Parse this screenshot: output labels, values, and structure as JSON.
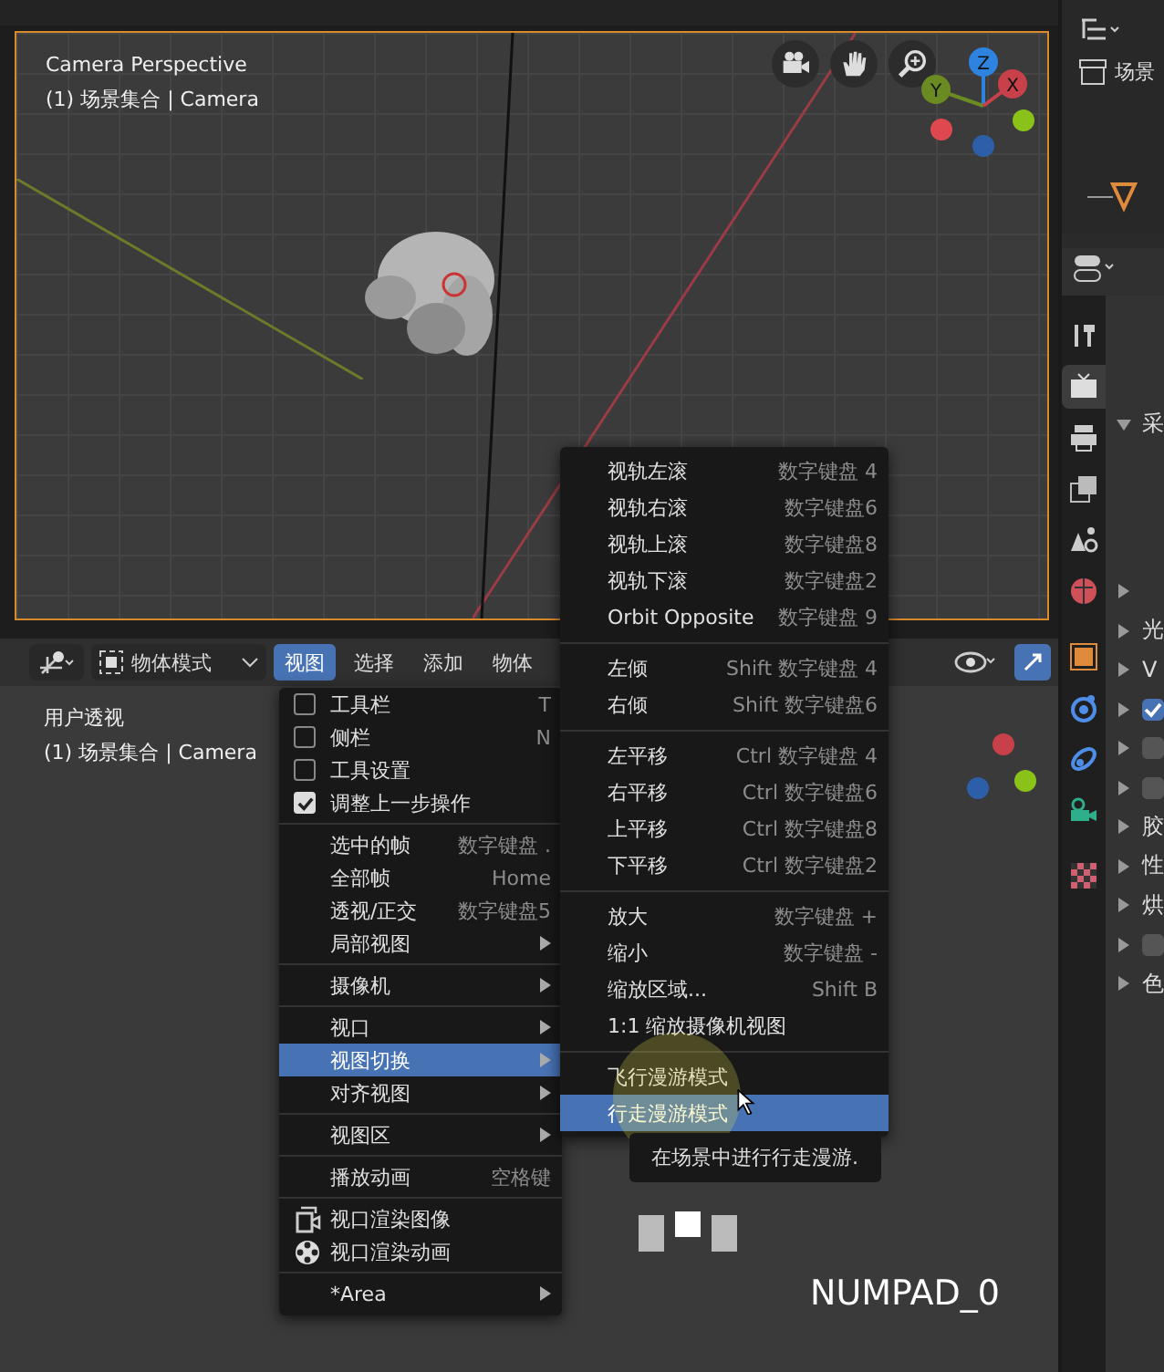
{
  "top_viewport": {
    "title": "Camera Perspective",
    "subtitle": "(1) 场景集合 | Camera",
    "axes": [
      {
        "label": "Z",
        "color": "#2f83e0"
      },
      {
        "label": "Y",
        "color": "#6a8a22"
      },
      {
        "label": "X",
        "color": "#c8404a"
      }
    ]
  },
  "header": {
    "mode": "物体模式",
    "menus": [
      {
        "label": "视图",
        "selected": true
      },
      {
        "label": "选择",
        "selected": false
      },
      {
        "label": "添加",
        "selected": false
      },
      {
        "label": "物体",
        "selected": false
      }
    ]
  },
  "bottom_viewport": {
    "title": "用户透视",
    "subtitle": "(1) 场景集合 | Camera"
  },
  "view_menu": {
    "items": [
      {
        "kind": "check",
        "label": "工具栏",
        "shortcut": "T",
        "checked": false,
        "submenu": false,
        "selected": false
      },
      {
        "kind": "check",
        "label": "侧栏",
        "shortcut": "N",
        "checked": false,
        "submenu": false,
        "selected": false
      },
      {
        "kind": "check",
        "label": "工具设置",
        "checked": false,
        "submenu": false,
        "selected": false
      },
      {
        "kind": "check",
        "label": "调整上一步操作",
        "checked": true,
        "submenu": false,
        "selected": false
      },
      {
        "kind": "separator"
      },
      {
        "kind": "plain",
        "label": "选中的帧",
        "shortcut": "数字键盘 .",
        "submenu": false,
        "selected": false
      },
      {
        "kind": "plain",
        "label": "全部帧",
        "shortcut": "Home",
        "submenu": false,
        "selected": false
      },
      {
        "kind": "plain",
        "label": "透视/正交",
        "shortcut": "数字键盘5",
        "submenu": false,
        "selected": false
      },
      {
        "kind": "plain",
        "label": "局部视图",
        "submenu": true,
        "selected": false
      },
      {
        "kind": "separator"
      },
      {
        "kind": "plain",
        "label": "摄像机",
        "submenu": true,
        "selected": false
      },
      {
        "kind": "separator"
      },
      {
        "kind": "plain",
        "label": "视口",
        "submenu": true,
        "selected": false
      },
      {
        "kind": "plain",
        "label": "视图切换",
        "submenu": true,
        "selected": true
      },
      {
        "kind": "plain",
        "label": "对齐视图",
        "submenu": true,
        "selected": false
      },
      {
        "kind": "separator"
      },
      {
        "kind": "plain",
        "label": "视图区",
        "submenu": true,
        "selected": false
      },
      {
        "kind": "separator"
      },
      {
        "kind": "plain",
        "label": "播放动画",
        "shortcut": "空格键",
        "submenu": false,
        "selected": false
      },
      {
        "kind": "separator"
      },
      {
        "kind": "picture",
        "label": "视口渲染图像",
        "submenu": false,
        "selected": false
      },
      {
        "kind": "film",
        "label": "视口渲染动画",
        "submenu": false,
        "selected": false
      },
      {
        "kind": "separator"
      },
      {
        "kind": "plain",
        "label": "*Area",
        "submenu": true,
        "selected": false
      }
    ]
  },
  "navigation_menu": {
    "items": [
      {
        "kind": "plain",
        "label": "视轨左滚",
        "shortcut": "数字键盘 4",
        "selected": false
      },
      {
        "kind": "plain",
        "label": "视轨右滚",
        "shortcut": "数字键盘6",
        "selected": false
      },
      {
        "kind": "plain",
        "label": "视轨上滚",
        "shortcut": "数字键盘8",
        "selected": false
      },
      {
        "kind": "plain",
        "label": "视轨下滚",
        "shortcut": "数字键盘2",
        "selected": false
      },
      {
        "kind": "plain",
        "label": "Orbit Opposite",
        "shortcut": "数字键盘 9",
        "selected": false
      },
      {
        "kind": "separator"
      },
      {
        "kind": "plain",
        "label": "左倾",
        "shortcut": "Shift 数字键盘 4",
        "selected": false
      },
      {
        "kind": "plain",
        "label": "右倾",
        "shortcut": "Shift 数字键盘6",
        "selected": false
      },
      {
        "kind": "separator"
      },
      {
        "kind": "plain",
        "label": "左平移",
        "shortcut": "Ctrl 数字键盘 4",
        "selected": false
      },
      {
        "kind": "plain",
        "label": "右平移",
        "shortcut": "Ctrl 数字键盘6",
        "selected": false
      },
      {
        "kind": "plain",
        "label": "上平移",
        "shortcut": "Ctrl 数字键盘8",
        "selected": false
      },
      {
        "kind": "plain",
        "label": "下平移",
        "shortcut": "Ctrl 数字键盘2",
        "selected": false
      },
      {
        "kind": "separator"
      },
      {
        "kind": "plain",
        "label": "放大",
        "shortcut": "数字键盘 +",
        "selected": false
      },
      {
        "kind": "plain",
        "label": "缩小",
        "shortcut": "数字键盘 -",
        "selected": false
      },
      {
        "kind": "plain",
        "label": "缩放区域...",
        "shortcut": "Shift B",
        "selected": false
      },
      {
        "kind": "plain",
        "label": "1:1 缩放摄像机视图",
        "selected": false
      },
      {
        "kind": "separator"
      },
      {
        "kind": "plain",
        "label": "飞行漫游模式",
        "selected": false
      },
      {
        "kind": "plain",
        "label": "行走漫游模式",
        "selected": true
      }
    ]
  },
  "tooltip": "在场景中进行行走漫游.",
  "key_display": "NUMPAD_0",
  "outliner": {
    "label": "场景"
  },
  "properties": {
    "tabs": [
      {
        "kind": "tool",
        "color": "#cccccc",
        "selected": false
      },
      {
        "kind": "render",
        "color": "#dddddd",
        "selected": true
      },
      {
        "kind": "output",
        "color": "#cccccc",
        "selected": false
      },
      {
        "kind": "image",
        "color": "#bbbbbb",
        "selected": false
      },
      {
        "kind": "scene",
        "color": "#cccccc",
        "selected": false
      },
      {
        "kind": "world",
        "color": "#d0505a",
        "selected": false
      },
      {
        "kind": "object",
        "color": "#e08a3c",
        "selected": false
      },
      {
        "kind": "physics",
        "color": "#4f8ee8",
        "selected": false
      },
      {
        "kind": "constraint",
        "color": "#4f8ee8",
        "selected": false
      },
      {
        "kind": "camera",
        "color": "#2fae8c",
        "selected": false
      },
      {
        "kind": "texture",
        "color": "#d06070",
        "selected": false
      }
    ],
    "rows": [
      {
        "kind": "section",
        "label": "采",
        "expanded": true
      },
      {
        "kind": "section",
        "expanded": false
      },
      {
        "kind": "section",
        "label": "光",
        "expanded": false
      },
      {
        "kind": "section",
        "label": "V",
        "expanded": false
      },
      {
        "kind": "check",
        "checked": true,
        "expanded": false
      },
      {
        "kind": "check",
        "checked": false,
        "expanded": false
      },
      {
        "kind": "check",
        "checked": false,
        "expanded": false
      },
      {
        "kind": "section",
        "label": "胶",
        "expanded": false
      },
      {
        "kind": "section",
        "label": "性",
        "expanded": false
      },
      {
        "kind": "section",
        "label": "烘",
        "expanded": false
      },
      {
        "kind": "check",
        "checked": false,
        "expanded": false
      },
      {
        "kind": "section",
        "label": "色",
        "expanded": false
      }
    ]
  }
}
